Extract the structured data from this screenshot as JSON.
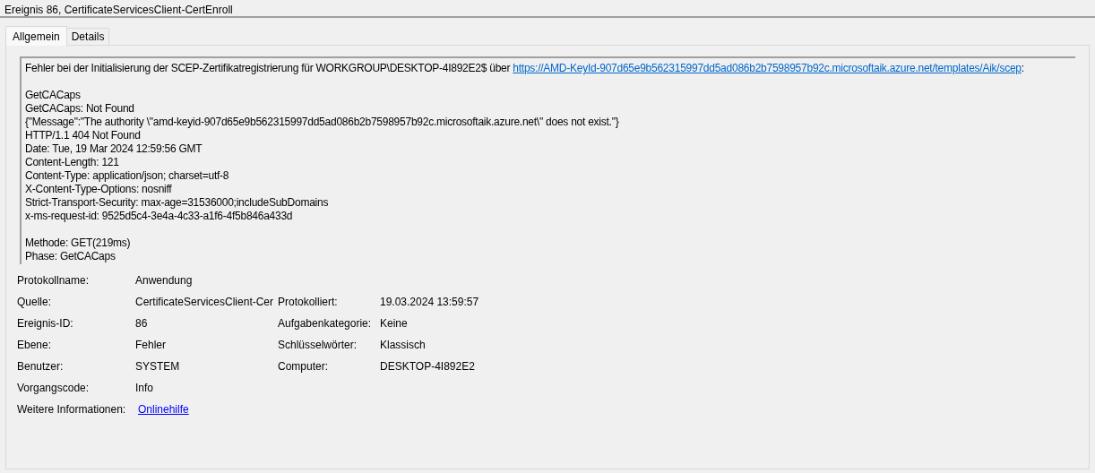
{
  "window": {
    "title": "Ereignis 86, CertificateServicesClient-CertEnroll"
  },
  "tabs": [
    {
      "label": "Allgemein",
      "selected": true
    },
    {
      "label": "Details",
      "selected": false
    }
  ],
  "message": {
    "intro": {
      "text": "Fehler bei der Initialisierung der SCEP-Zertifikatregistrierung für WORKGROUP\\DESKTOP-4I892E2$ über",
      "link": "https://AMD-KeyId-907d65e9b562315997dd5ad086b2b7598957b92c.microsoftaik.azure.net/templates/Aik/scep",
      "after": ":"
    },
    "blocks": [
      [
        "GetCACaps",
        "GetCACaps: Not Found",
        "{\"Message\":\"The authority \\\"amd-keyid-907d65e9b562315997dd5ad086b2b7598957b92c.microsoftaik.azure.net\\\" does not exist.\"}",
        "HTTP/1.1 404 Not Found",
        "Date: Tue, 19 Mar 2024 12:59:56 GMT",
        "Content-Length: 121",
        "Content-Type: application/json; charset=utf-8",
        "X-Content-Type-Options: nosniff",
        "Strict-Transport-Security: max-age=31536000;includeSubDomains",
        "x-ms-request-id: 9525d5c4-3e4a-4c33-a1f6-4f5b846a433d"
      ],
      [
        "Methode: GET(219ms)",
        "Phase: GetCACaps"
      ]
    ]
  },
  "properties": [
    {
      "left": {
        "label": "Protokollname:",
        "value": "Anwendung",
        "kind": "text"
      }
    },
    {
      "left": {
        "label": "Quelle:",
        "value": "CertificateServicesClient-Cer",
        "kind": "text"
      },
      "right": {
        "label": "Protokolliert:",
        "value": "19.03.2024 13:59:57"
      }
    },
    {
      "left": {
        "label": "Ereignis-ID:",
        "value": "86",
        "kind": "text"
      },
      "right": {
        "label": "Aufgabenkategorie:",
        "value": "Keine"
      }
    },
    {
      "left": {
        "label": "Ebene:",
        "value": "Fehler",
        "kind": "text"
      },
      "right": {
        "label": "Schlüsselwörter:",
        "value": "Klassisch"
      }
    },
    {
      "left": {
        "label": "Benutzer:",
        "value": "SYSTEM",
        "kind": "text"
      },
      "right": {
        "label": "Computer:",
        "value": "DESKTOP-4I892E2"
      }
    },
    {
      "left": {
        "label": "Vorgangscode:",
        "value": "Info",
        "kind": "text"
      }
    },
    {
      "left": {
        "label": "Weitere Informationen:",
        "value": "Onlinehilfe",
        "kind": "link"
      }
    }
  ]
}
